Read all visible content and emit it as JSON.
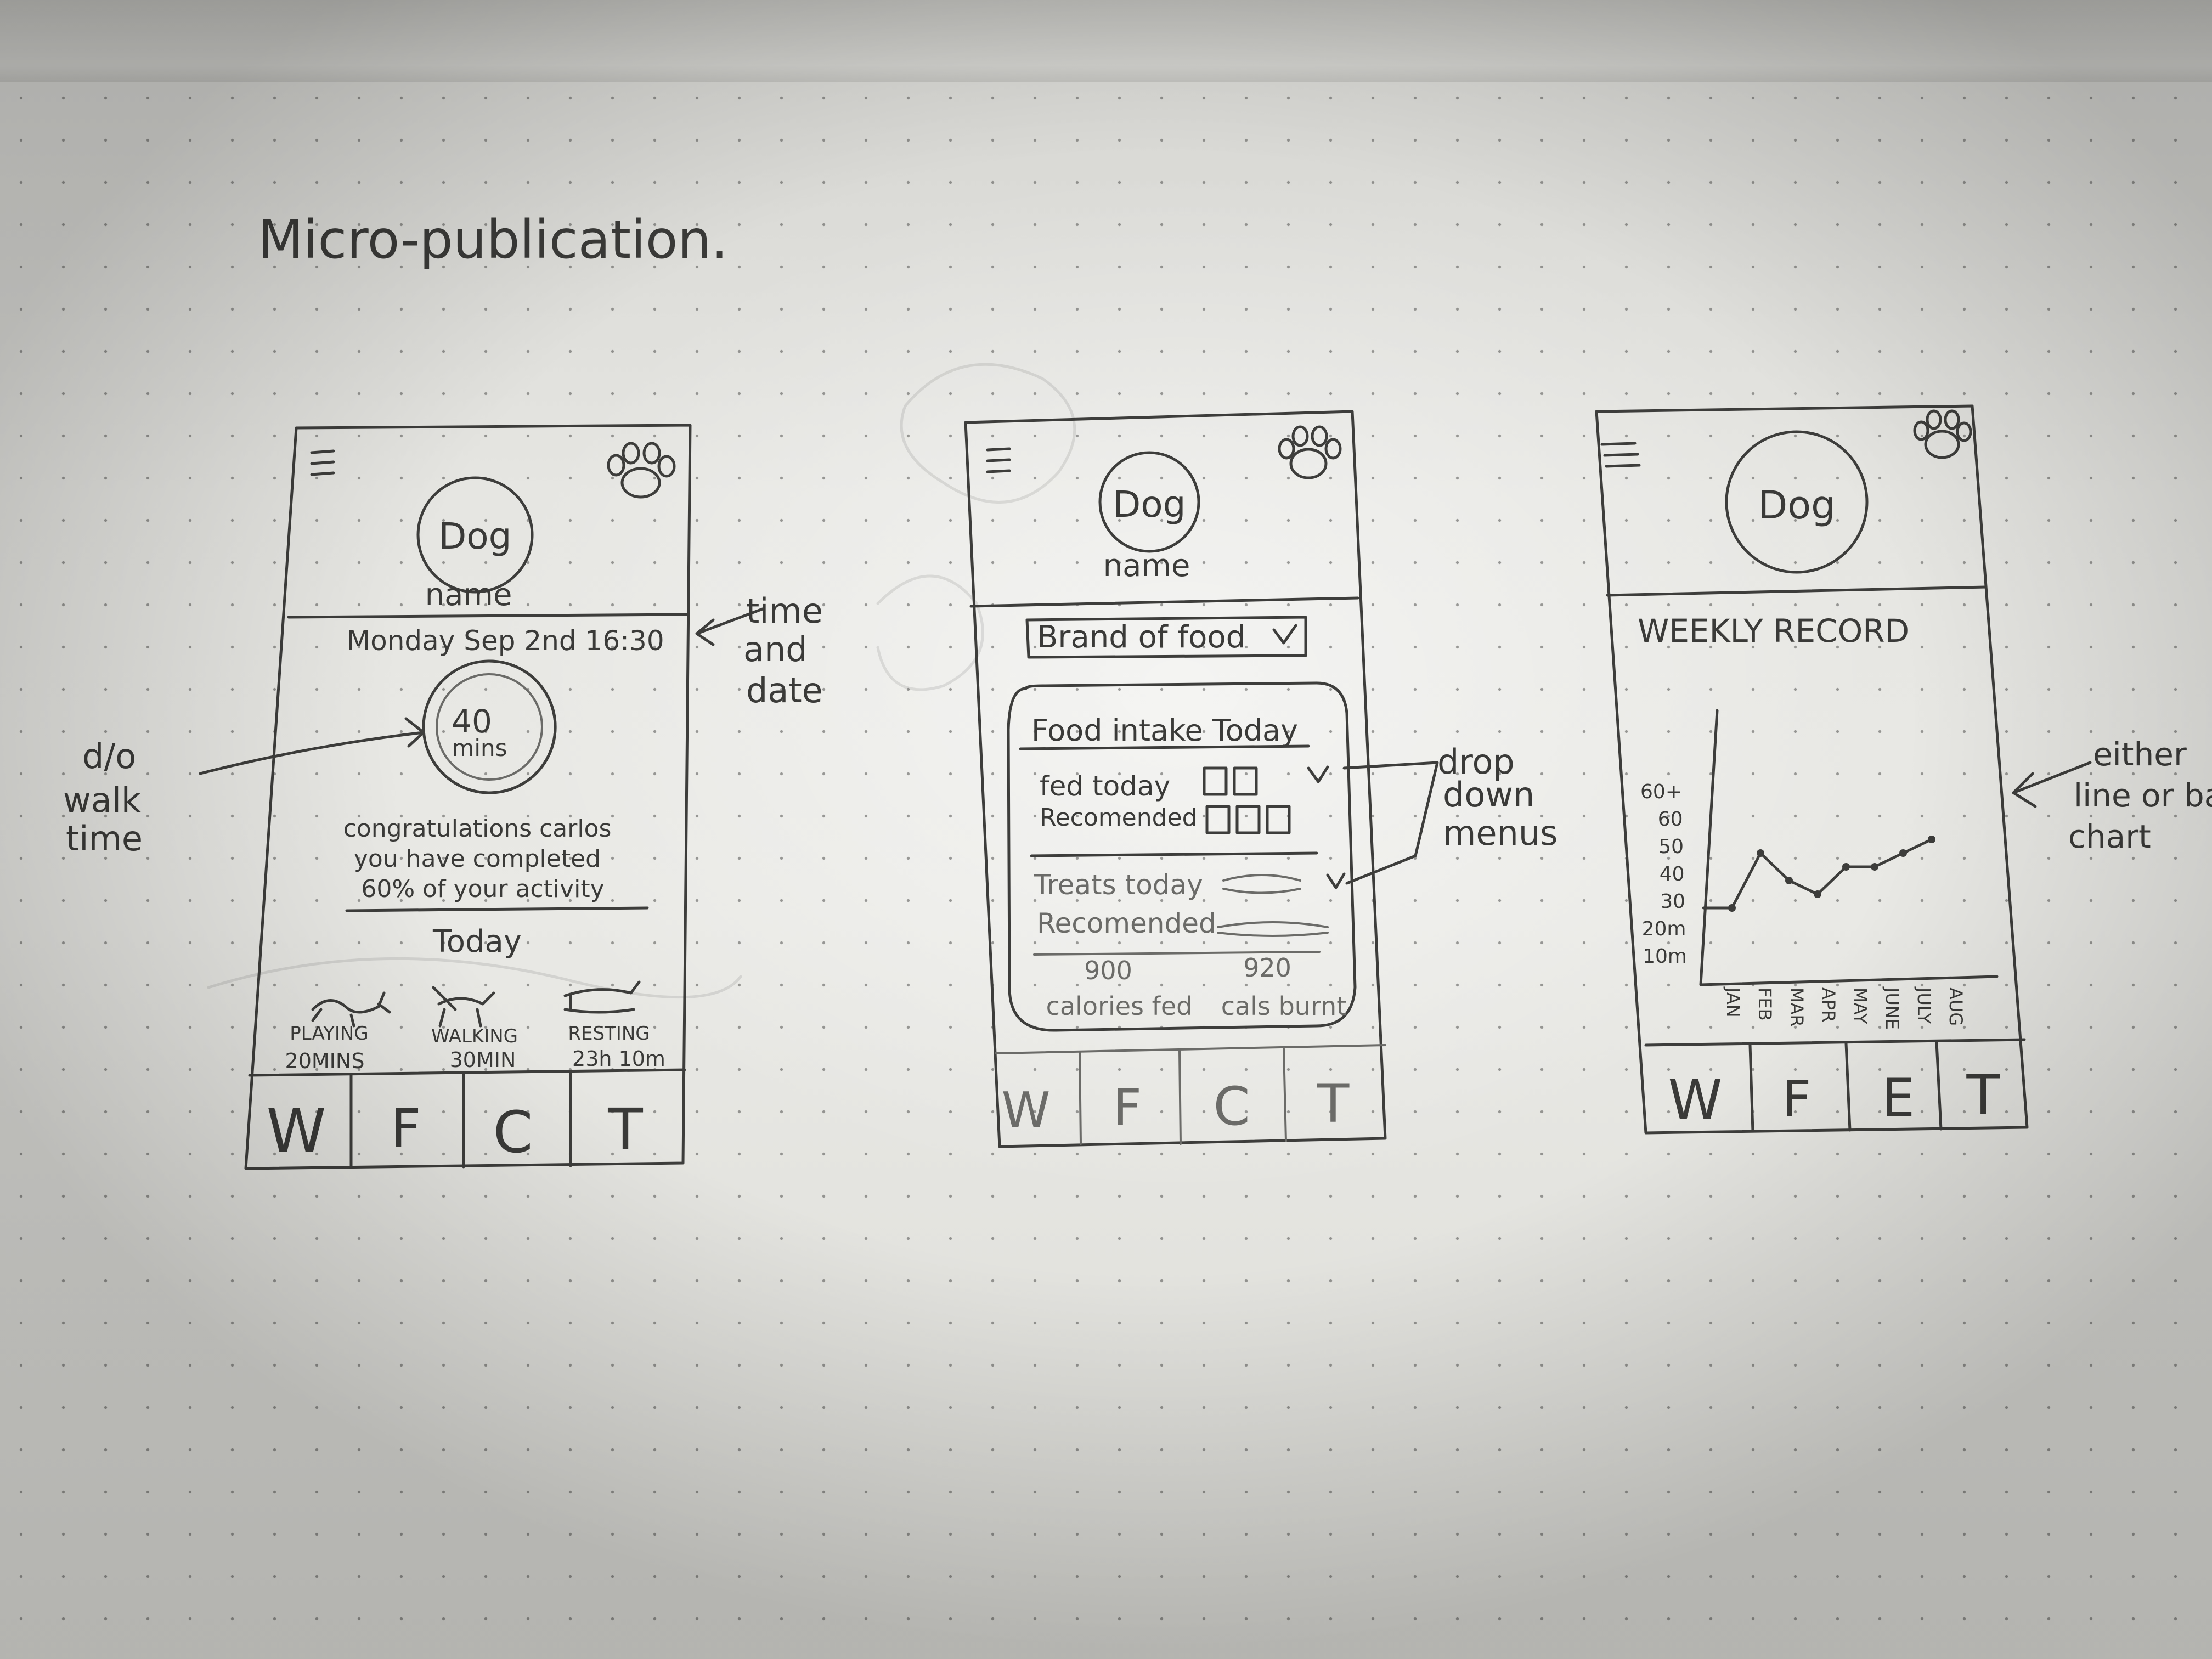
{
  "page_title": "Micro-publication.",
  "screen1": {
    "dog": "Dog",
    "name": "name",
    "datetime": "Monday Sep 2nd 16:30",
    "ring_value": "40",
    "ring_unit": "mins",
    "congrats": [
      "congratulations carlos",
      "you have completed",
      "60% of your activity"
    ],
    "today": "Today",
    "activities": [
      {
        "label": "PLAYING",
        "value": "20MINS"
      },
      {
        "label": "WALKING",
        "value": "30MIN"
      },
      {
        "label": "RESTING",
        "value": "23h 10m"
      }
    ],
    "tabs": [
      "W",
      "F",
      "C",
      "T"
    ]
  },
  "screen2": {
    "dog": "Dog",
    "name": "name",
    "dropdown": "Brand of food",
    "card_title": "Food intake Today",
    "fed_today": "fed today",
    "recommended": "Recomended",
    "treats_today": "Treats today",
    "recommended2": "Recomended",
    "cal_fed_value": "900",
    "cal_fed_label": "calories fed",
    "cal_burnt_value": "920",
    "cal_burnt_label": "cals burnt",
    "tabs": [
      "W",
      "F",
      "C",
      "T"
    ]
  },
  "screen3": {
    "dog": "Dog",
    "title": "WEEKLY RECORD",
    "tabs": [
      "W",
      "F",
      "E",
      "T"
    ]
  },
  "annotations": {
    "time_and_date": [
      "time",
      "and",
      "date"
    ],
    "walk_time": [
      "d/o",
      "walk",
      "time"
    ],
    "drop_down": [
      "drop",
      "down",
      "menus"
    ],
    "chart_note": [
      "either",
      "line or ba",
      "chart"
    ]
  },
  "chart_data": {
    "type": "line",
    "x": [
      "JAN",
      "FEB",
      "MAR",
      "APR",
      "MAY",
      "JUNE",
      "JULY",
      "AUG"
    ],
    "y": [
      30,
      30,
      50,
      40,
      35,
      45,
      45,
      50,
      55
    ],
    "y_tick_labels": [
      "10m",
      "20m",
      "30",
      "40",
      "50",
      "60",
      "60+"
    ],
    "title": "WEEKLY RECORD"
  }
}
